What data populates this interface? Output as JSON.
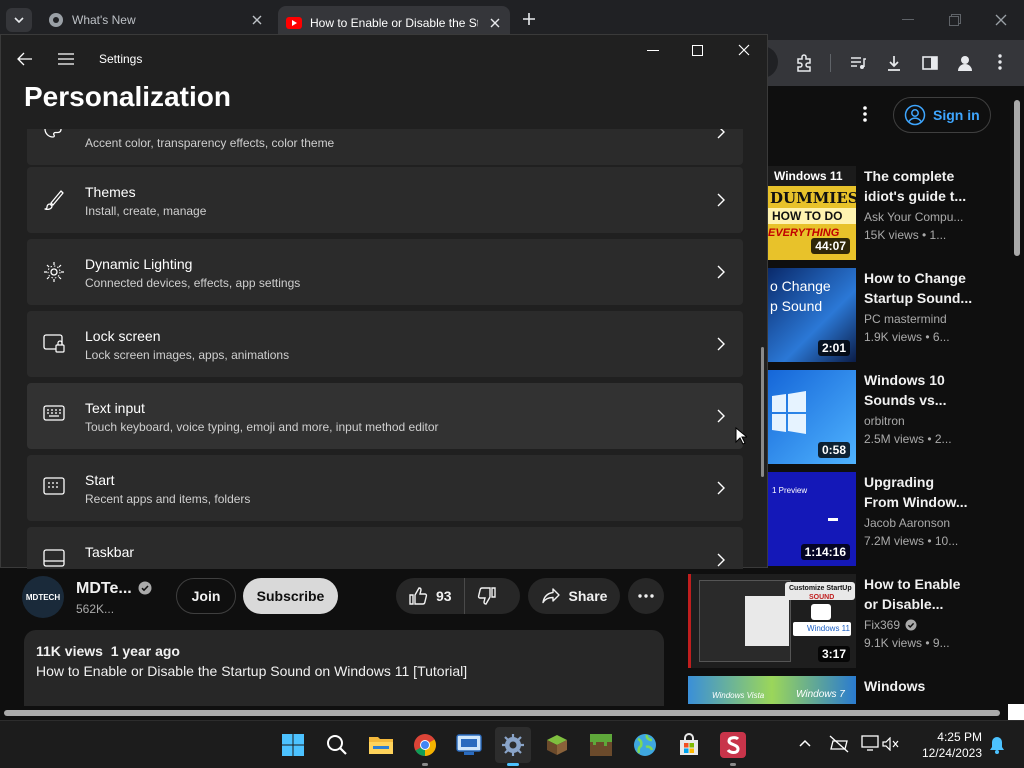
{
  "browser": {
    "tabs": [
      {
        "title": "What's New"
      },
      {
        "title": "How to Enable or Disable the St"
      }
    ]
  },
  "youtube": {
    "sign_in": "Sign in",
    "channel": {
      "name": "MDTe...",
      "subs": "562K...",
      "avatar_text": "MDTECH"
    },
    "join": "Join",
    "subscribe": "Subscribe",
    "likes": "93",
    "share": "Share",
    "desc": {
      "views_date": "11K views  1 year ago",
      "title": "How to Enable or Disable the Startup Sound on Windows 11 [Tutorial]"
    },
    "recommendations": [
      {
        "title1": "The complete",
        "title2": "idiot's guide t...",
        "channel": "Ask Your Compu...",
        "stats": "15K views  • 1...",
        "duration": "44:07",
        "thumb_text": [
          "Windows 11",
          "DUMMIES",
          "HOW TO DO",
          "EVERYTHING"
        ]
      },
      {
        "title1": "How to Change",
        "title2": "Startup Sound...",
        "channel": "PC mastermind",
        "stats": "1.9K views  • 6...",
        "duration": "2:01",
        "thumb_text": [
          "o Change",
          "p Sound"
        ]
      },
      {
        "title1": "Windows 10",
        "title2": "Sounds vs...",
        "channel": "orbitron",
        "stats": "2.5M views  • 2...",
        "duration": "0:58"
      },
      {
        "title1": "Upgrading",
        "title2": "From Window...",
        "channel": "Jacob Aaronson",
        "stats": "7.2M views  • 10...",
        "duration": "1:14:16",
        "thumb_text": [
          "1 Preview"
        ]
      },
      {
        "title1": "How to Enable",
        "title2": "or Disable...",
        "channel": "Fix369",
        "stats": "9.1K views  • 9...",
        "duration": "3:17",
        "thumb_text": [
          "Customize StartUp",
          "SOUND",
          "Windows 11"
        ]
      },
      {
        "title1": "Windows",
        "thumb_text": [
          "Windows Vista",
          "Windows 7"
        ]
      }
    ]
  },
  "settings": {
    "app_title": "Settings",
    "page_title": "Personalization",
    "partial_row_subtitle": "Accent color, transparency effects, color theme",
    "rows": [
      {
        "title": "Themes",
        "subtitle": "Install, create, manage"
      },
      {
        "title": "Dynamic Lighting",
        "subtitle": "Connected devices, effects, app settings"
      },
      {
        "title": "Lock screen",
        "subtitle": "Lock screen images, apps, animations"
      },
      {
        "title": "Text input",
        "subtitle": "Touch keyboard, voice typing, emoji and more, input method editor"
      },
      {
        "title": "Start",
        "subtitle": "Recent apps and items, folders"
      },
      {
        "title": "Taskbar",
        "subtitle": ""
      }
    ]
  },
  "taskbar": {
    "time": "4:25 PM",
    "date": "12/24/2023"
  },
  "colors": {
    "accent_blue": "#3ea6ff",
    "win_blue": "#4cc2ff",
    "youtube_red": "#ff0000"
  }
}
